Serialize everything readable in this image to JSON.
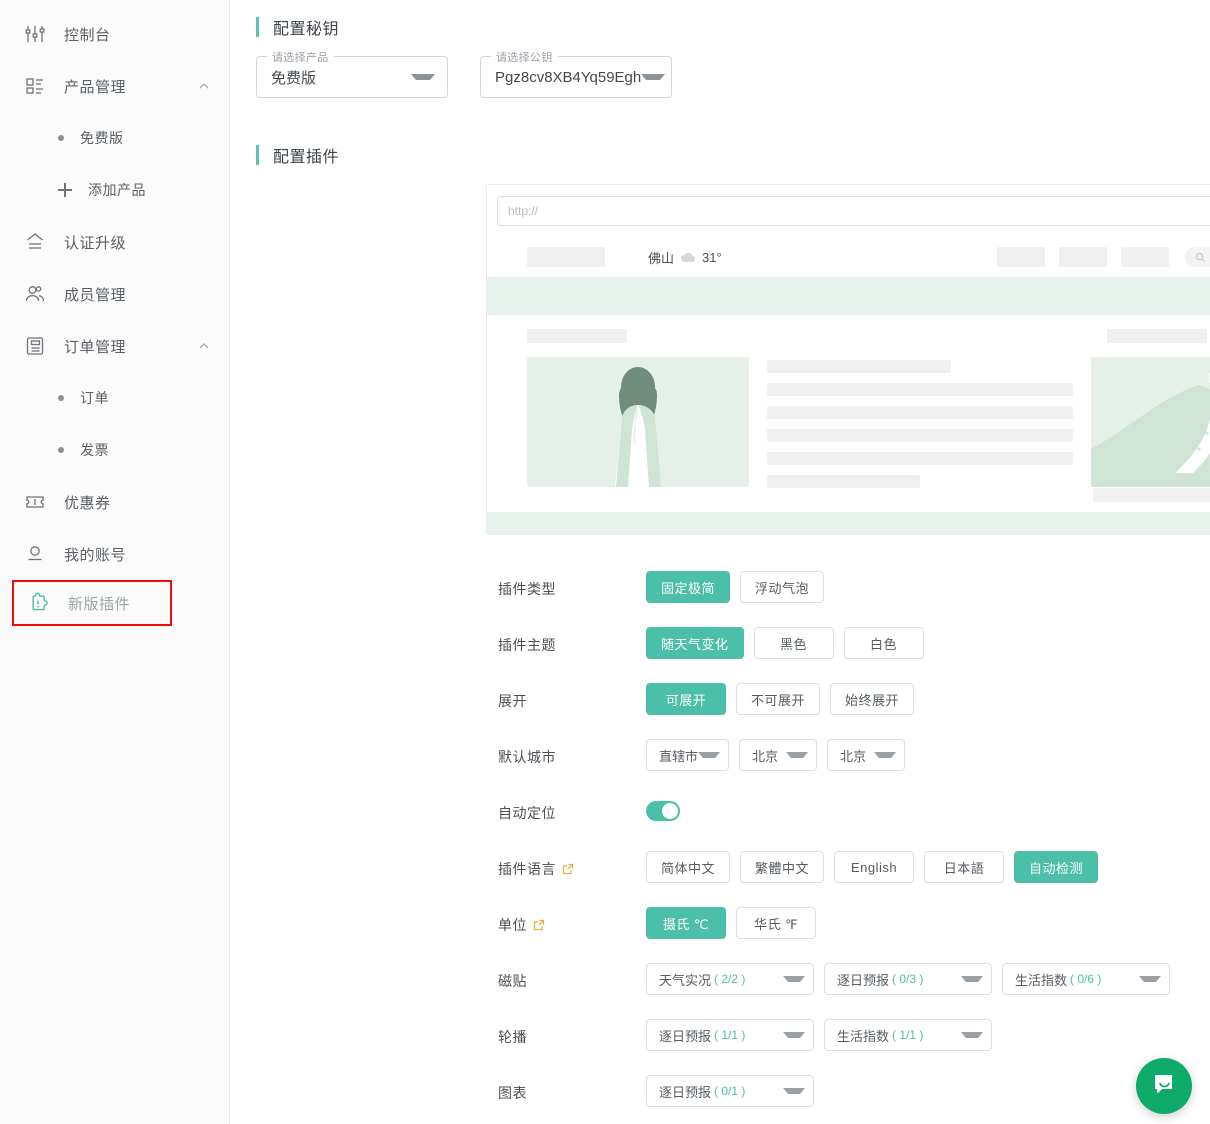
{
  "sidebar": {
    "items": [
      {
        "label": "控制台",
        "icon": "sliders-icon",
        "type": "item"
      },
      {
        "label": "产品管理",
        "icon": "list-grid-icon",
        "type": "group",
        "expanded": true,
        "caret": "chevron-up-icon"
      },
      {
        "label": "免费版",
        "type": "sub",
        "icon": "bullet-icon"
      },
      {
        "label": "添加产品",
        "type": "sub-add",
        "icon": "plus-icon"
      },
      {
        "label": "认证升级",
        "icon": "upgrade-icon",
        "type": "item"
      },
      {
        "label": "成员管理",
        "icon": "users-icon",
        "type": "item"
      },
      {
        "label": "订单管理",
        "icon": "clipboard-icon",
        "type": "group",
        "expanded": true,
        "caret": "chevron-up-icon"
      },
      {
        "label": "订单",
        "type": "sub",
        "icon": "bullet-icon"
      },
      {
        "label": "发票",
        "type": "sub",
        "icon": "bullet-icon"
      },
      {
        "label": "优惠券",
        "icon": "ticket-icon",
        "type": "item"
      },
      {
        "label": "我的账号",
        "icon": "person-icon",
        "type": "item"
      },
      {
        "label": "新版插件",
        "icon": "puzzle-icon",
        "type": "item",
        "highlighted": true
      }
    ]
  },
  "key_section": {
    "title": "配置秘钥",
    "product_select": {
      "label": "请选择产品",
      "value": "免费版"
    },
    "key_select": {
      "label": "请选择公钥",
      "value": "Pgz8cv8XB4Yq59Egh"
    }
  },
  "plugin_section": {
    "title": "配置插件"
  },
  "preview": {
    "url_placeholder": "http://",
    "desktop_icon": "desktop-icon",
    "mobile_icon": "mobile-icon",
    "expand_icon": "expand-icon",
    "mock_city": "佛山",
    "mock_temp": "31°"
  },
  "form": {
    "rows": [
      {
        "key": "plugin_type",
        "label": "插件类型",
        "control": "buttons",
        "options": [
          {
            "label": "固定极简",
            "selected": true
          },
          {
            "label": "浮动气泡",
            "selected": false
          }
        ]
      },
      {
        "key": "plugin_theme",
        "label": "插件主题",
        "control": "buttons",
        "options": [
          {
            "label": "随天气变化",
            "selected": true
          },
          {
            "label": "黑色",
            "selected": false
          },
          {
            "label": "白色",
            "selected": false
          }
        ]
      },
      {
        "key": "expand",
        "label": "展开",
        "control": "buttons",
        "options": [
          {
            "label": "可展开",
            "selected": true
          },
          {
            "label": "不可展开",
            "selected": false
          },
          {
            "label": "始终展开",
            "selected": false
          }
        ]
      },
      {
        "key": "default_city",
        "label": "默认城市",
        "control": "selects",
        "selects": [
          {
            "value": "直辖市"
          },
          {
            "value": "北京"
          },
          {
            "value": "北京"
          }
        ]
      },
      {
        "key": "auto_locate",
        "label": "自动定位",
        "control": "toggle",
        "toggle_on": true
      },
      {
        "key": "plugin_language",
        "label": "插件语言",
        "ext_icon": "external-link-icon",
        "control": "buttons",
        "options": [
          {
            "label": "简体中文",
            "selected": false
          },
          {
            "label": "繁體中文",
            "selected": false
          },
          {
            "label": "English",
            "selected": false
          },
          {
            "label": "日本語",
            "selected": false
          },
          {
            "label": "自动检测",
            "selected": true
          }
        ]
      },
      {
        "key": "unit",
        "label": "单位",
        "ext_icon": "external-link-icon",
        "control": "buttons",
        "options": [
          {
            "label": "摄氏 ℃",
            "selected": true
          },
          {
            "label": "华氏 ℉",
            "selected": false
          }
        ]
      },
      {
        "key": "tiles",
        "label": "磁贴",
        "control": "count-selects",
        "selects": [
          {
            "name": "天气实况",
            "count": "( 2/2 )"
          },
          {
            "name": "逐日预报",
            "count": "( 0/3 )"
          },
          {
            "name": "生活指数",
            "count": "( 0/6 )"
          }
        ]
      },
      {
        "key": "carousel",
        "label": "轮播",
        "control": "count-selects",
        "selects": [
          {
            "name": "逐日预报",
            "count": "( 1/1 )"
          },
          {
            "name": "生活指数",
            "count": "( 1/1 )"
          }
        ]
      },
      {
        "key": "chart",
        "label": "图表",
        "control": "count-selects",
        "selects": [
          {
            "name": "逐日预报",
            "count": "( 0/1 )"
          }
        ]
      }
    ]
  },
  "chat": {
    "icon": "chat-bubble-icon",
    "color": "#0daa6a"
  },
  "colors": {
    "accent": "#4cbfa8",
    "highlight_border": "#f20c0c",
    "ext_link": "#e8ac40"
  }
}
